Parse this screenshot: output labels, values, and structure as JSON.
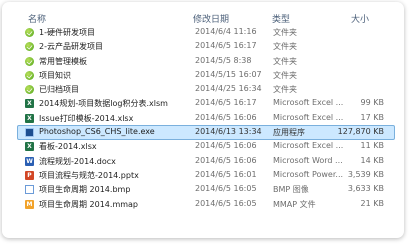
{
  "columns": {
    "name": "名称",
    "date": "修改日期",
    "type": "类型",
    "size": "大小"
  },
  "rows": [
    {
      "name": "1-硬件研发项目",
      "date": "2014/6/4 11:16",
      "type": "文件夹",
      "size": "",
      "icon": "folder-check-icon"
    },
    {
      "name": "2-云产品研发项目",
      "date": "2014/6/5 16:17",
      "type": "文件夹",
      "size": "",
      "icon": "folder-check-icon"
    },
    {
      "name": "常用管理模板",
      "date": "2014/5/5 8:38",
      "type": "文件夹",
      "size": "",
      "icon": "folder-check-icon"
    },
    {
      "name": "项目知识",
      "date": "2014/5/15 16:07",
      "type": "文件夹",
      "size": "",
      "icon": "folder-check-icon"
    },
    {
      "name": "已归档项目",
      "date": "2014/4/25 16:34",
      "type": "文件夹",
      "size": "",
      "icon": "folder-check-icon"
    },
    {
      "name": "2014规划-项目数据log积分表.xlsm",
      "date": "2014/6/5 16:17",
      "type": "Microsoft Excel ...",
      "size": "99 KB",
      "icon": "excel-icon"
    },
    {
      "name": "Issue打印模板-2014.xlsx",
      "date": "2014/6/5 16:06",
      "type": "Microsoft Excel ...",
      "size": "17 KB",
      "icon": "excel-icon"
    },
    {
      "name": "Photoshop_CS6_CHS_lite.exe",
      "date": "2014/6/13 13:34",
      "type": "应用程序",
      "size": "127,870 KB",
      "icon": "exe-icon",
      "selected": true
    },
    {
      "name": "看板-2014.xlsx",
      "date": "2014/6/5 16:06",
      "type": "Microsoft Excel ...",
      "size": "11 KB",
      "icon": "excel-icon"
    },
    {
      "name": "流程规划-2014.docx",
      "date": "2014/6/5 16:06",
      "type": "Microsoft Word ...",
      "size": "14 KB",
      "icon": "word-icon"
    },
    {
      "name": "项目流程与规范-2014.pptx",
      "date": "2014/6/5 16:01",
      "type": "Microsoft Power...",
      "size": "3,539 KB",
      "icon": "powerpoint-icon"
    },
    {
      "name": "项目生命周期 2014.bmp",
      "date": "2014/6/5 16:05",
      "type": "BMP 图像",
      "size": "3,633 KB",
      "icon": "bitmap-icon"
    },
    {
      "name": "项目生命周期 2014.mmap",
      "date": "2014/6/5 16:05",
      "type": "MMAP 文件",
      "size": "21 KB",
      "icon": "mindmap-icon"
    }
  ]
}
